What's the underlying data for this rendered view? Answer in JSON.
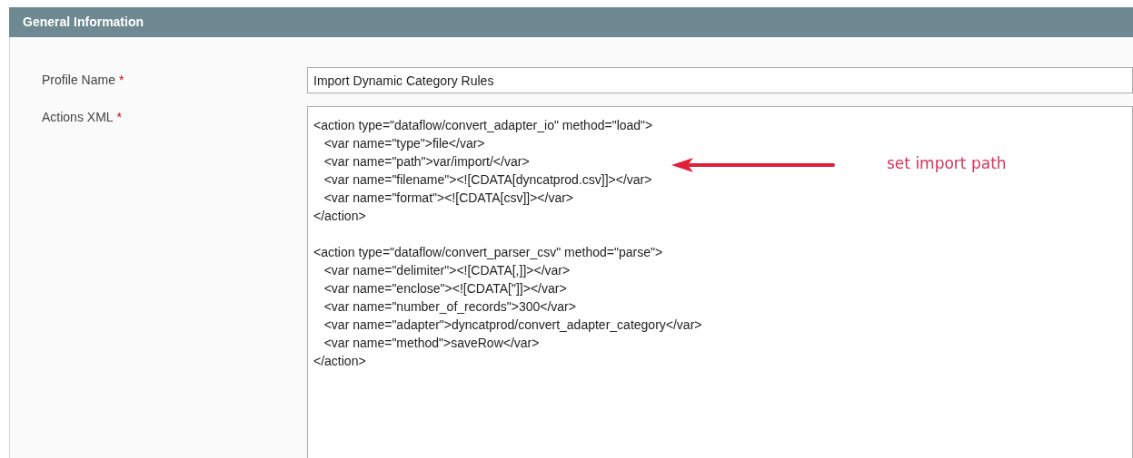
{
  "panel": {
    "title": "General Information"
  },
  "required_mark": "*",
  "profile_name": {
    "label": "Profile Name",
    "required": true,
    "value": "Import Dynamic Category Rules"
  },
  "actions_xml": {
    "label": "Actions XML",
    "required": true,
    "blocks": [
      {
        "open": "<action type=\"dataflow/convert_adapter_io\" method=\"load\">",
        "vars": [
          "<var name=\"type\">file</var>",
          "<var name=\"path\">var/import/</var>",
          "<var name=\"filename\"><![CDATA[dyncatprod.csv]]></var>",
          "<var name=\"format\"><![CDATA[csv]]></var>"
        ],
        "close": "</action>"
      },
      {
        "open": "<action type=\"dataflow/convert_parser_csv\" method=\"parse\">",
        "vars": [
          "<var name=\"delimiter\"><![CDATA[,]]></var>",
          "<var name=\"enclose\"><![CDATA[\"]]></var>",
          "<var name=\"number_of_records\">300</var>",
          "<var name=\"adapter\">dyncatprod/convert_adapter_category</var>",
          "<var name=\"method\">saveRow</var>"
        ],
        "close": "</action>"
      }
    ]
  },
  "annotation": {
    "text": "set import path"
  }
}
